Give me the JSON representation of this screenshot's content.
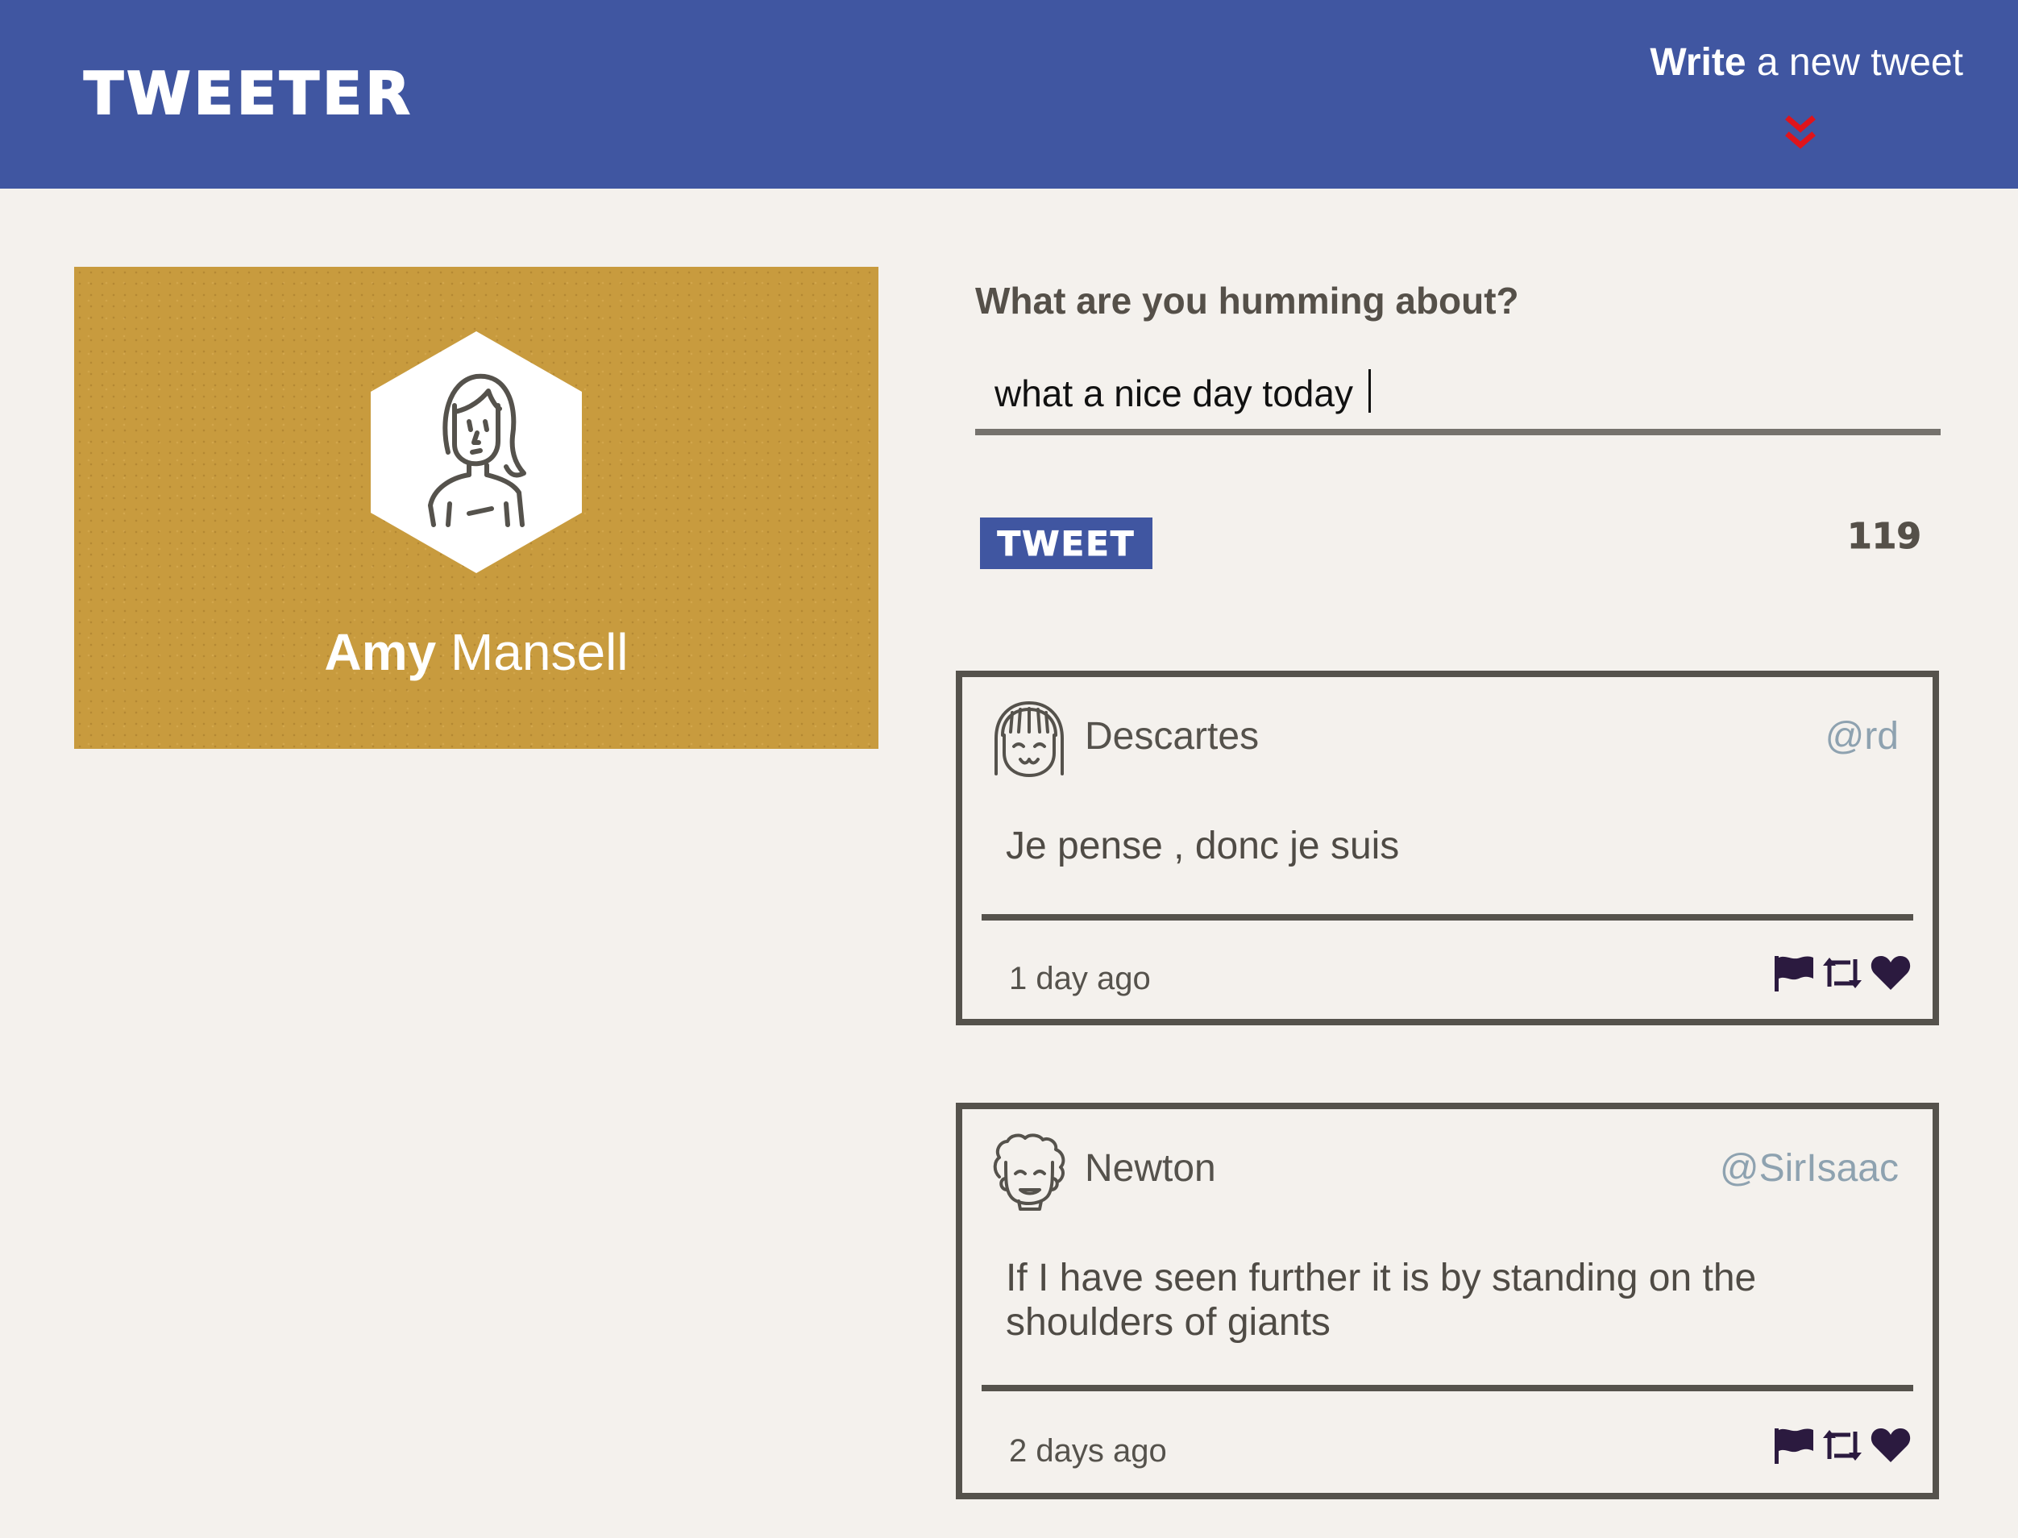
{
  "header": {
    "brand": "TWEETER",
    "compose_toggle": {
      "strong": "Write",
      "rest": " a new tweet"
    },
    "chevron_icon": "double-chevron-down-icon",
    "chevron_color": "#e0141b",
    "background": "#4056a1"
  },
  "profile": {
    "first_name": "Amy",
    "last_name": " Mansell",
    "avatar_icon": "woman-avatar-icon",
    "background": "#c89b3e"
  },
  "composer": {
    "prompt": "What are you humming about?",
    "value": "what a nice day today",
    "button_label": "TWEET",
    "remaining_chars": "119"
  },
  "tweets": [
    {
      "name": "Descartes",
      "handle": "@rd",
      "text": "Je pense , donc je suis",
      "time": "1 day ago",
      "avatar_icon": "smiling-face-avatar-icon"
    },
    {
      "name": "Newton",
      "handle": "@SirIsaac",
      "text": "If I have seen further it is by standing on the shoulders of giants",
      "time": "2 days ago",
      "avatar_icon": "curly-hair-avatar-icon"
    }
  ],
  "actions": {
    "flag_icon": "flag-icon",
    "retweet_icon": "retweet-icon",
    "like_icon": "heart-icon",
    "icon_color": "#2b1a3f"
  }
}
